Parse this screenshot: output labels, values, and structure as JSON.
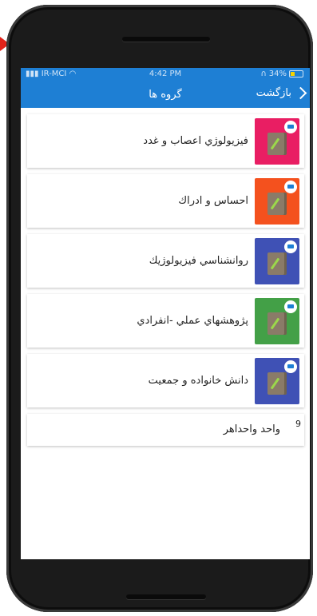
{
  "status_bar": {
    "carrier": "IR-MCI",
    "time": "4:42 PM",
    "battery": "34%"
  },
  "nav": {
    "title": "گروه ها",
    "back_label": "بازگشت"
  },
  "groups": [
    {
      "label": "فيزيولوژي اعصاب و غدد",
      "color": "#e91e63"
    },
    {
      "label": "احساس و ادراك",
      "color": "#f4511e"
    },
    {
      "label": "روانشناسي فيزيولوژيك",
      "color": "#3f51b5"
    },
    {
      "label": "پژوهشهاي عملي -انفرادي",
      "color": "#43a047"
    },
    {
      "label": "دانش خانواده و جمعيت",
      "color": "#3f51b5"
    }
  ],
  "extra_item": {
    "number": "9",
    "label": "واحد واحداهر"
  }
}
